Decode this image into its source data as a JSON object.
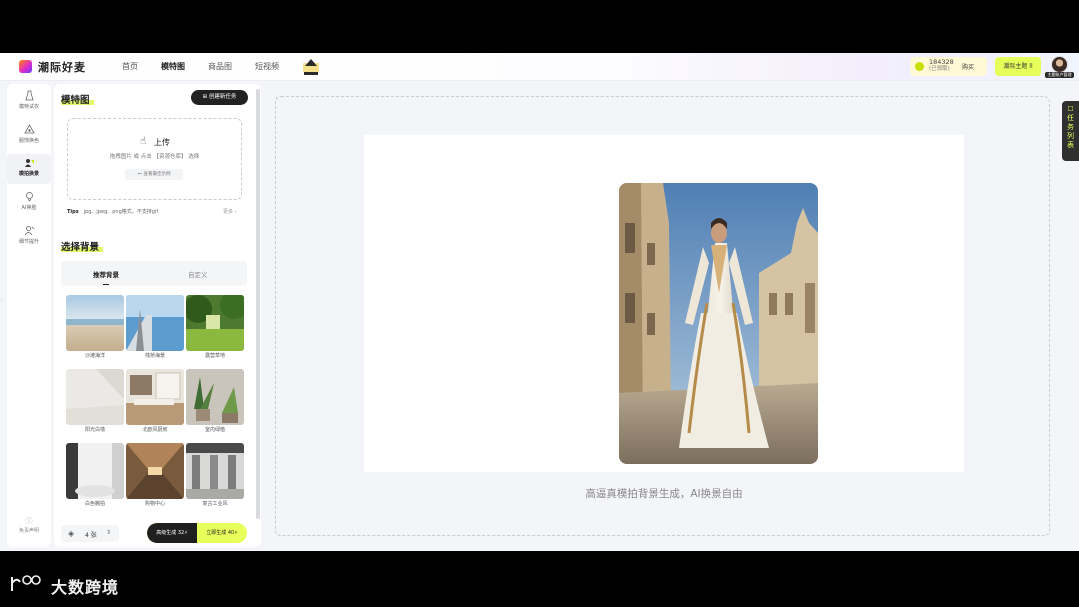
{
  "header": {
    "app_name": "潮际好麦",
    "nav": [
      {
        "label": "首页"
      },
      {
        "label": "模特图"
      },
      {
        "label": "商品图"
      },
      {
        "label": "短视频"
      }
    ],
    "active_nav": "模特图",
    "credits": {
      "value": "184328",
      "label": "(已领取)",
      "buy_label": "购买"
    },
    "upgrade_label": "潮际主题 ll",
    "avatar_tag": "主题账户管理"
  },
  "rail": {
    "items": [
      {
        "label": "模特试衣",
        "icon": "dress-icon"
      },
      {
        "label": "服饰换色",
        "icon": "palette-icon"
      },
      {
        "label": "模拍换景",
        "icon": "scene-icon"
      },
      {
        "label": "AI换脸",
        "icon": "face-icon"
      },
      {
        "label": "细节提升",
        "icon": "person-icon"
      }
    ],
    "active_index": 2,
    "footer_label": "免责声明"
  },
  "panel": {
    "title": "模特图",
    "new_task_label": "创建新任务",
    "upload": {
      "title": "上传",
      "hint": "拖拽图片 或 点击 【资源仓库】 选择",
      "example": "查看最佳示例"
    },
    "tips": {
      "label": "Tips",
      "text": "jpg、jpeg、png格式，不支持gif",
      "more": "更多"
    },
    "section_title": "选择背景",
    "tabs": [
      {
        "label": "推荐背景"
      },
      {
        "label": "自定义"
      }
    ],
    "active_tab": 0,
    "backgrounds": [
      {
        "label": "沙滩海洋"
      },
      {
        "label": "栈桥海景"
      },
      {
        "label": "露营草地"
      },
      {
        "label": "阳光白墙"
      },
      {
        "label": "北欧风厨房"
      },
      {
        "label": "室内绿植"
      },
      {
        "label": "白色棚拍"
      },
      {
        "label": "购物中心"
      },
      {
        "label": "复古工业风"
      }
    ],
    "quantity": {
      "value": "4 张",
      "stepper": "⇕"
    },
    "generate": {
      "left_label": "高级生成 32⚡",
      "right_label": "立即生成 40⚡"
    }
  },
  "main": {
    "caption": "高逼真模拍背景生成，AI换景自由",
    "side_tab_label": "任务列表"
  },
  "watermark": {
    "text": "大数跨境"
  },
  "colors": {
    "accent": "#e4f86a",
    "dark": "#222222",
    "background": "#f4f5f8"
  }
}
